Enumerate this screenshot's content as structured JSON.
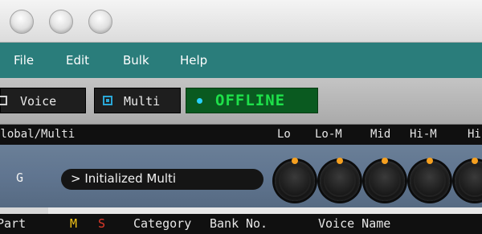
{
  "window": {
    "traffic_lights": [
      "close-button",
      "minimize-button",
      "zoom-button"
    ]
  },
  "menu": {
    "items": [
      "File",
      "Edit",
      "Bulk",
      "Help"
    ]
  },
  "toolbar": {
    "voice_label": "Voice",
    "multi_label": "Multi",
    "status_label": "OFFLINE",
    "status_color": "#1ee04a"
  },
  "global_header": {
    "title": "Global/Multi",
    "eq_bands": [
      "Lo",
      "Lo-M",
      "Mid",
      "Hi-M",
      "Hi"
    ]
  },
  "multi": {
    "part_id": "G",
    "name": "Initialized Multi",
    "expand_glyph": ">"
  },
  "part_header": {
    "part": "Part",
    "mute": "M",
    "solo": "S",
    "category": "Category",
    "bank": "Bank",
    "number": "No.",
    "voice_name": "Voice Name"
  },
  "colors": {
    "menubar": "#2a7d7b",
    "accent_orange": "#f5a020",
    "mute": "#f5c518",
    "solo": "#e03a2a"
  }
}
